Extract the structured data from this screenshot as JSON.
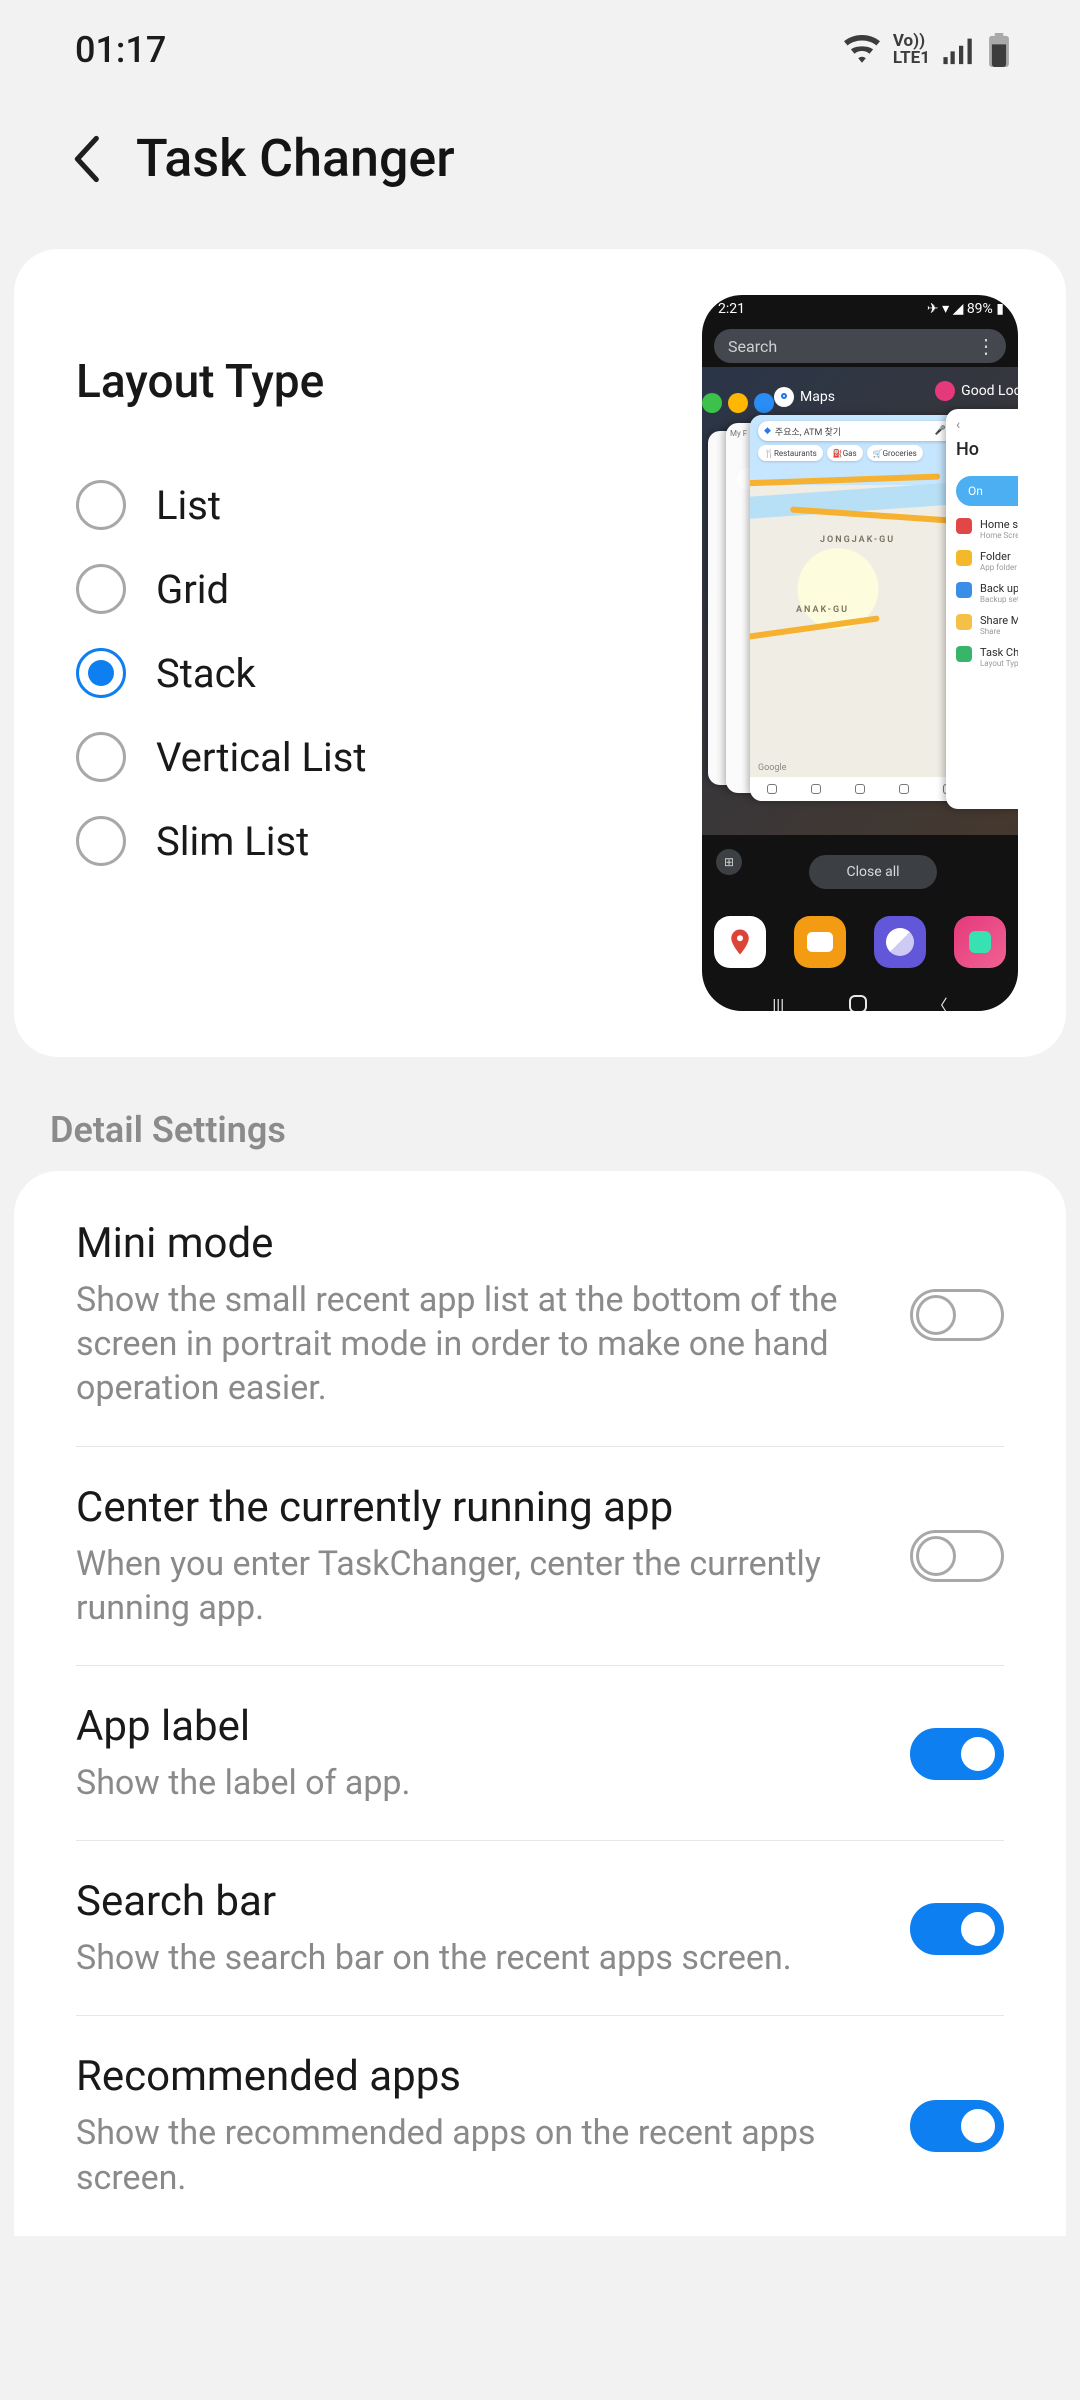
{
  "status": {
    "time": "01:17",
    "lte_label": "LTE1",
    "vo_label": "Vo))"
  },
  "header": {
    "title": "Task Changer"
  },
  "layout": {
    "title": "Layout Type",
    "options": [
      "List",
      "Grid",
      "Stack",
      "Vertical List",
      "Slim List"
    ],
    "selected": "Stack"
  },
  "preview": {
    "time": "2:21",
    "battery_text": "89%",
    "search_placeholder": "Search",
    "labels": {
      "maps": "Maps",
      "goodlock": "Good Lock"
    },
    "map": {
      "search_text": "주요소, ATM 찾기",
      "chips": [
        "Restaurants",
        "Gas",
        "Groceries"
      ],
      "areas": [
        "JONGJAK-GU",
        "ANAK-GU"
      ],
      "google": "Google"
    },
    "detail_card": {
      "title": "Ho",
      "state": "On",
      "items": [
        "Home scr",
        "Folder",
        "Back up a",
        "Share Ma",
        "Task Cha"
      ]
    },
    "close_all": "Close all"
  },
  "section_title": "Detail Settings",
  "settings": [
    {
      "key": "mini_mode",
      "title": "Mini mode",
      "sub": "Show the small recent app list at the bottom of the screen in portrait mode in order to make one hand operation easier.",
      "on": false
    },
    {
      "key": "center_running",
      "title": "Center the currently running app",
      "sub": "When you enter TaskChanger, center the currently running app.",
      "on": false
    },
    {
      "key": "app_label",
      "title": "App label",
      "sub": "Show the label of app.",
      "on": true
    },
    {
      "key": "search_bar",
      "title": "Search bar",
      "sub": "Show the search bar on the recent apps screen.",
      "on": true
    },
    {
      "key": "recommended",
      "title": "Recommended apps",
      "sub": "Show the recommended apps on the recent apps screen.",
      "on": true
    }
  ]
}
